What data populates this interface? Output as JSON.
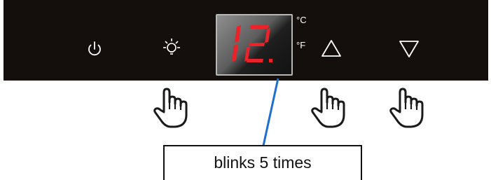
{
  "control_panel": {
    "power_icon": "power-icon",
    "light_icon": "light-icon",
    "up_icon": "triangle-up-icon",
    "down_icon": "triangle-down-icon",
    "display": {
      "value": "12.",
      "color": "#e8232a"
    },
    "units": {
      "celsius": "°C",
      "fahrenheit": "°F"
    }
  },
  "hands": [
    "hand-pointer-icon",
    "hand-pointer-icon",
    "hand-pointer-icon"
  ],
  "callout": {
    "text": "blinks 5 times",
    "line_color": "#1e6fd0"
  }
}
